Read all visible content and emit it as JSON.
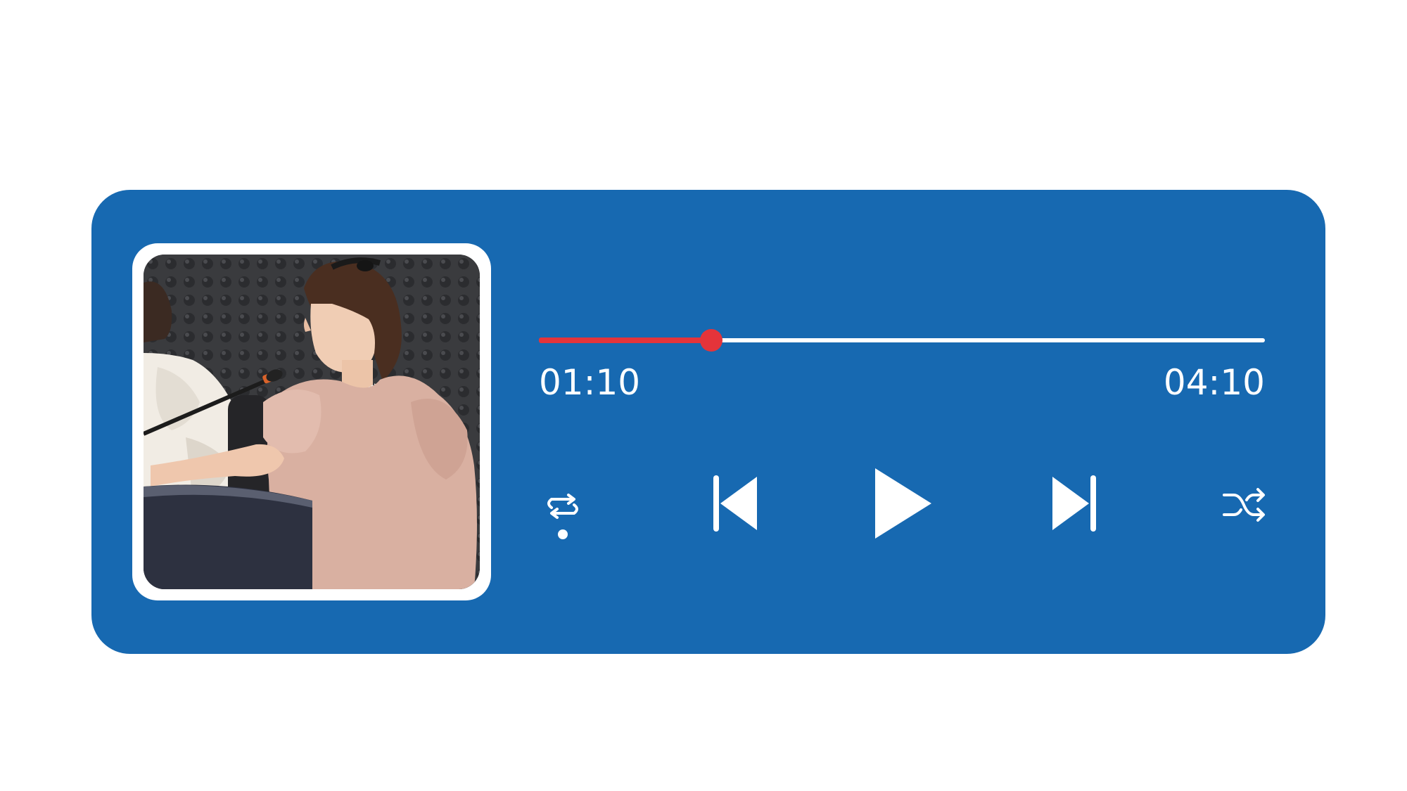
{
  "player": {
    "background_color": "#1769b1",
    "accent_color": "#e4343a",
    "elapsed": "01:10",
    "total": "04:10",
    "progress_fraction": 0.237,
    "album_art": "photo-two-women-speaking-at-microphone-in-studio",
    "controls": {
      "repeat": "repeat-icon",
      "previous": "skip-previous-icon",
      "play": "play-icon",
      "next": "skip-next-icon",
      "shuffle": "shuffle-icon"
    }
  }
}
